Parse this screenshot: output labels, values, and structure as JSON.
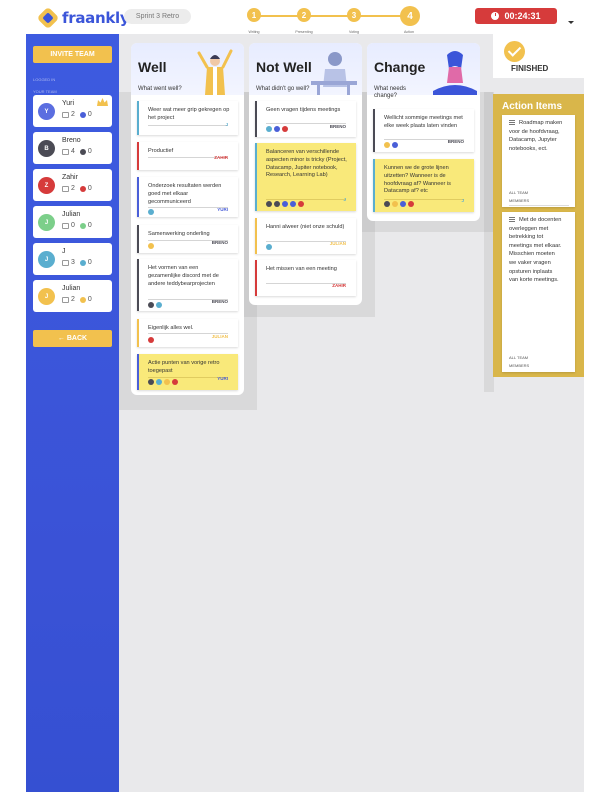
{
  "app": {
    "name": "fraankly"
  },
  "header": {
    "retro_name": "Sprint 3 Retro",
    "steps": [
      {
        "num": "1",
        "label": "Writing"
      },
      {
        "num": "2",
        "label": "Presenting"
      },
      {
        "num": "3",
        "label": "Voting"
      },
      {
        "num": "4",
        "label": "Action"
      }
    ],
    "timer": "00:24:31"
  },
  "sidebar": {
    "invite_label": "INVITE TEAM",
    "logged_in_label": "LOGGED IN",
    "your_team_label": "YOUR TEAM",
    "back_label": "← BACK",
    "users": [
      {
        "initial": "Y",
        "name": "Yuri",
        "count": "2",
        "dot_count": "0",
        "avatar_color": "#5b6ee0",
        "dot_color": "#4a5fd8",
        "owner": true
      },
      {
        "initial": "B",
        "name": "Breno",
        "count": "4",
        "dot_count": "0",
        "avatar_color": "#4b4b55",
        "dot_color": "#4b4b55",
        "owner": false
      },
      {
        "initial": "Z",
        "name": "Zahir",
        "count": "2",
        "dot_count": "0",
        "avatar_color": "#d63b3b",
        "dot_color": "#d63b3b",
        "owner": false
      },
      {
        "initial": "J",
        "name": "Julian",
        "count": "0",
        "dot_count": "0",
        "avatar_color": "#7ccf8a",
        "dot_color": "#7ccf8a",
        "owner": false
      },
      {
        "initial": "J",
        "name": "J",
        "count": "3",
        "dot_count": "0",
        "avatar_color": "#5aaecf",
        "dot_color": "#5aaecf",
        "owner": false
      },
      {
        "initial": "J",
        "name": "Julian",
        "count": "2",
        "dot_count": "0",
        "avatar_color": "#f2c14e",
        "dot_color": "#f2c14e",
        "owner": false
      }
    ]
  },
  "columns": {
    "well": {
      "title": "Well",
      "subtitle": "What went well?",
      "cards": [
        {
          "text": "Weer wat meer grip gekregen op het project",
          "author": "J",
          "author_color": "#5aaecf",
          "border": "#5aaecf",
          "yellow": false
        },
        {
          "text": "Productief",
          "author": "ZAHIR",
          "author_color": "#d63b3b",
          "border": "#d63b3b",
          "yellow": false
        },
        {
          "text": "Onderzoek resultaten werden goed met elkaar gecommuniceerd",
          "author": "YURI",
          "author_color": "#4a5fd8",
          "border": "#4a5fd8",
          "yellow": false,
          "dots": [
            "#5aaecf"
          ]
        },
        {
          "text": "Samenwerking onderling",
          "author": "BRENO",
          "author_color": "#4b4b55",
          "border": "#4b4b55",
          "yellow": false,
          "dots": [
            "#f2c14e"
          ]
        },
        {
          "text": "Het vormen van een gezamenlijke discord met de andere teddybearprojecten",
          "author": "BRENO",
          "author_color": "#4b4b55",
          "border": "#4b4b55",
          "yellow": false,
          "dots": [
            "#4b4b55",
            "#5aaecf"
          ]
        },
        {
          "text": "Eigenlijk alles wel.",
          "author": "JULIAN",
          "author_color": "#f2c14e",
          "border": "#f2c14e",
          "yellow": false,
          "dots": [
            "#d63b3b"
          ]
        },
        {
          "text": "Actie punten van vorige retro toegepast",
          "author": "YURI",
          "author_color": "#4a5fd8",
          "border": "#4a5fd8",
          "yellow": true,
          "dots": [
            "#4b4b55",
            "#5aaecf",
            "#f2c14e",
            "#d63b3b"
          ]
        }
      ]
    },
    "notwell": {
      "title": "Not Well",
      "subtitle": "What didn't go well?",
      "cards": [
        {
          "text": "Geen vragen tijdens meetings",
          "author": "BRENO",
          "author_color": "#4b4b55",
          "border": "#4b4b55",
          "yellow": false,
          "dots": [
            "#5aaecf",
            "#4a5fd8",
            "#d63b3b"
          ]
        },
        {
          "text": "Balanceren van verschillende aspecten minor is tricky (Project, Datacamp, Jupiter notebook, Research, Learning Lab)",
          "author": "J",
          "author_color": "#5aaecf",
          "border": "#5aaecf",
          "yellow": true,
          "dots": [
            "#4b4b55",
            "#4b4b55",
            "#4a5fd8",
            "#4a5fd8",
            "#d63b3b"
          ]
        },
        {
          "text": "Hanni alweer (niet onze schuld)",
          "author": "JULIAN",
          "author_color": "#f2c14e",
          "border": "#f2c14e",
          "yellow": false,
          "dots": [
            "#5aaecf"
          ]
        },
        {
          "text": "Het missen van een meeting",
          "author": "ZAHIR",
          "author_color": "#d63b3b",
          "border": "#d63b3b",
          "yellow": false
        }
      ]
    },
    "change": {
      "title": "Change",
      "subtitle": "What needs change?",
      "cards": [
        {
          "text": "Wellicht sommige meetings met elke week plaats laten vinden",
          "author": "BRENO",
          "author_color": "#4b4b55",
          "border": "#4b4b55",
          "yellow": false,
          "dots": [
            "#f2c14e",
            "#4a5fd8"
          ]
        },
        {
          "text": "Kunnen we de grote lijnen uitzetten? Wanneer is de hoofdvraag af? Wanneer is Datacamp af? etc",
          "author": "J",
          "author_color": "#5aaecf",
          "border": "#5aaecf",
          "yellow": true,
          "dots": [
            "#4b4b55",
            "#f2c14e",
            "#4a5fd8",
            "#d63b3b"
          ]
        }
      ]
    }
  },
  "finished": {
    "label": "FINISHED"
  },
  "action_items": {
    "title": "Action Items",
    "items": [
      {
        "text": "Roadmap maken voor de hoofdvraag, Datacamp, Jupyter notebooks, ect.",
        "members": "ALL TEAM MEMBERS"
      },
      {
        "text": "Met de docenten overleggen met betrekking tot meetings met elkaar. Misschien moeten we vaker vragen opsturen inplaats van korte meetings.",
        "members": "ALL TEAM MEMBERS"
      }
    ]
  }
}
